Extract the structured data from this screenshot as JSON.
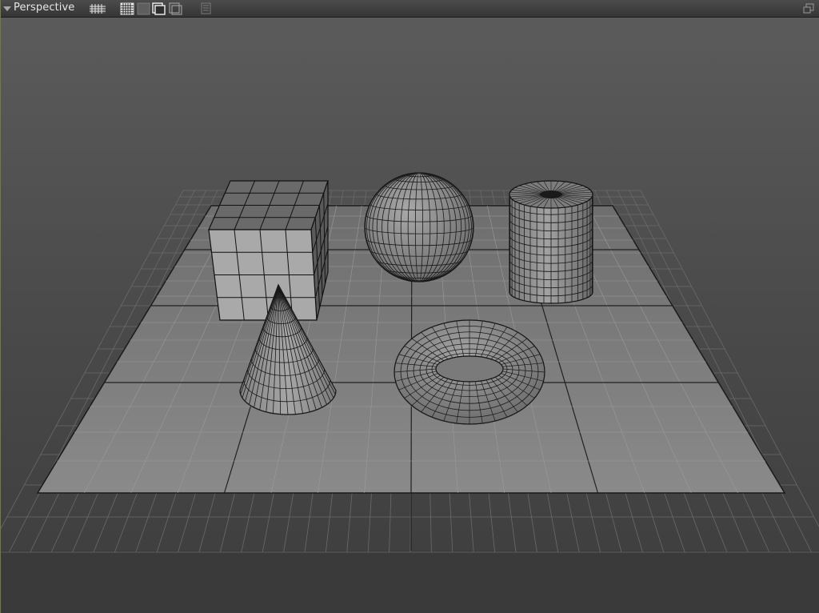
{
  "viewport": {
    "title": "Perspective",
    "toolbar": [
      {
        "name": "grid-toggle-icon"
      },
      {
        "name": "checker-shading-icon"
      },
      {
        "name": "solid-shading-icon"
      },
      {
        "name": "wireframe-box-icon"
      },
      {
        "name": "xray-box-icon"
      },
      {
        "name": "panel-options-icon"
      }
    ],
    "maximize": {
      "name": "maximize-viewport-icon"
    }
  },
  "scene": {
    "objects": [
      "cube",
      "sphere",
      "cylinder",
      "cone",
      "torus"
    ],
    "colors": {
      "sky_top": "#5a5a5a",
      "sky_bottom": "#3e3e3e",
      "floor_band": "#3a3a3a",
      "plane": "#858585",
      "wire": "#111111"
    }
  }
}
